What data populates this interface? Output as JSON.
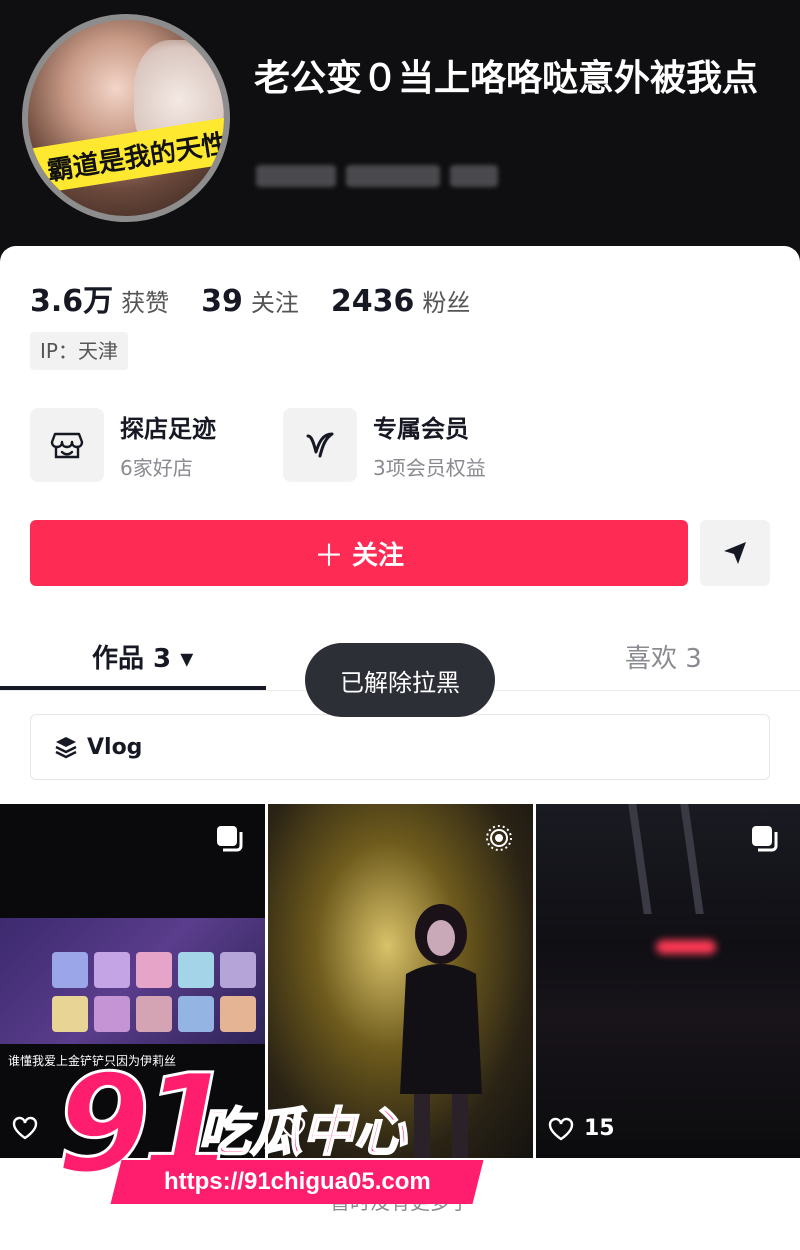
{
  "header": {
    "avatar_caption": "霸道是我的天性",
    "title": "老公变０当上咯咯哒意外被我点"
  },
  "stats": {
    "likes_num": "3.6万",
    "likes_label": "获赞",
    "following_num": "39",
    "following_label": "关注",
    "fans_num": "2436",
    "fans_label": "粉丝"
  },
  "ip_tag": "IP：天津",
  "features": [
    {
      "title": "探店足迹",
      "subtitle": "6家好店",
      "icon": "store-icon"
    },
    {
      "title": "专属会员",
      "subtitle": "3项会员权益",
      "icon": "v-member-icon"
    }
  ],
  "actions": {
    "follow_plus": "＋",
    "follow_label": "关注",
    "share_icon": "send-icon"
  },
  "tabs": {
    "works": "作品 3 ▾",
    "likes": "喜欢 3"
  },
  "toast": "已解除拉黑",
  "collection": {
    "label": "Vlog",
    "icon": "layers-icon"
  },
  "videos": [
    {
      "caption": "谁懂我爱上金铲铲只因为伊莉丝",
      "likes": "",
      "badge": "multi-image"
    },
    {
      "caption": "",
      "likes": "",
      "badge": "live-photo"
    },
    {
      "caption": "",
      "likes": "15",
      "badge": "multi-image"
    }
  ],
  "footer": "暂时没有更多了",
  "watermark": {
    "number": "91",
    "text": "吃瓜中心",
    "url": "https://91chigua05.com"
  },
  "colors": {
    "primary": "#fe2c55",
    "header_bg": "#0f0f11",
    "watermark": "#ff1e6e"
  }
}
